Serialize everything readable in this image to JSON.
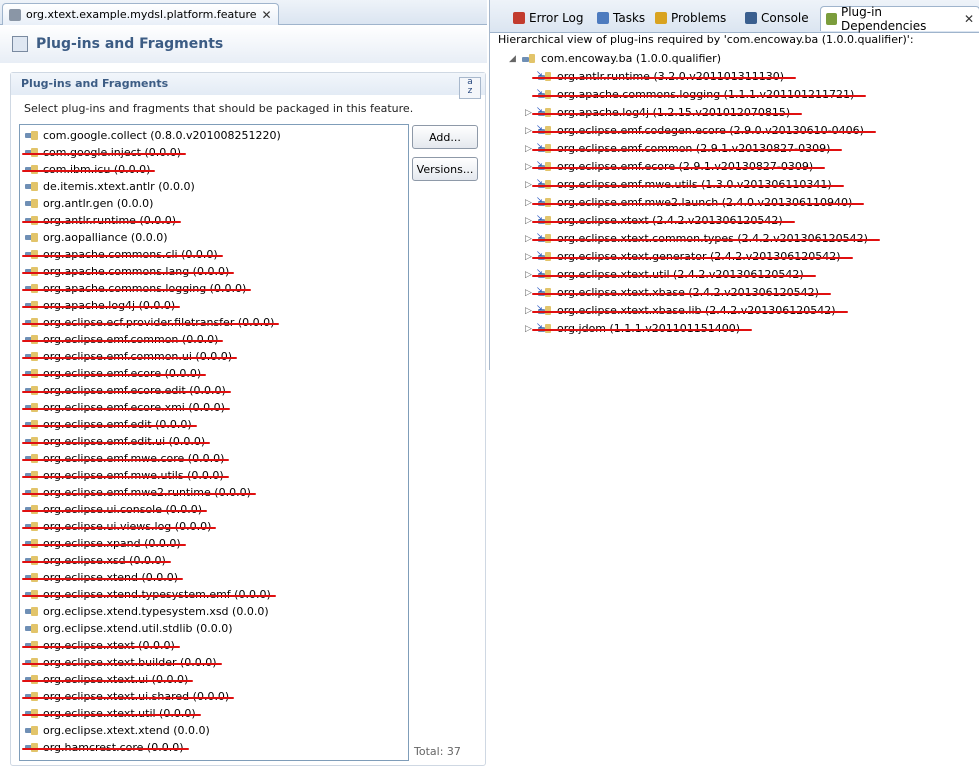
{
  "editor": {
    "tab_title": "org.xtext.example.mydsl.platform.feature",
    "page_title": "Plug-ins and Fragments",
    "section_title": "Plug-ins and Fragments",
    "section_description": "Select plug-ins and fragments that should be packaged in this feature.",
    "sort_button_label": "a\nz",
    "add_button": "Add...",
    "versions_button": "Versions...",
    "total_label": "Total: 37",
    "plugins": [
      {
        "label": "com.google.collect (0.8.0.v201008251220)",
        "struck": false
      },
      {
        "label": "com.google.inject (0.0.0)",
        "struck": true
      },
      {
        "label": "com.ibm.icu (0.0.0)",
        "struck": true
      },
      {
        "label": "de.itemis.xtext.antlr (0.0.0)",
        "struck": false
      },
      {
        "label": "org.antlr.gen (0.0.0)",
        "struck": false
      },
      {
        "label": "org.antlr.runtime (0.0.0)",
        "struck": true
      },
      {
        "label": "org.aopalliance (0.0.0)",
        "struck": false
      },
      {
        "label": "org.apache.commons.cli (0.0.0)",
        "struck": true
      },
      {
        "label": "org.apache.commons.lang (0.0.0)",
        "struck": true
      },
      {
        "label": "org.apache.commons.logging (0.0.0)",
        "struck": true
      },
      {
        "label": "org.apache.log4j (0.0.0)",
        "struck": true
      },
      {
        "label": "org.eclipse.ecf.provider.filetransfer (0.0.0)",
        "struck": true
      },
      {
        "label": "org.eclipse.emf.common (0.0.0)",
        "struck": true
      },
      {
        "label": "org.eclipse.emf.common.ui (0.0.0)",
        "struck": true
      },
      {
        "label": "org.eclipse.emf.ecore (0.0.0)",
        "struck": true
      },
      {
        "label": "org.eclipse.emf.ecore.edit (0.0.0)",
        "struck": true
      },
      {
        "label": "org.eclipse.emf.ecore.xmi (0.0.0)",
        "struck": true
      },
      {
        "label": "org.eclipse.emf.edit (0.0.0)",
        "struck": true
      },
      {
        "label": "org.eclipse.emf.edit.ui (0.0.0)",
        "struck": true
      },
      {
        "label": "org.eclipse.emf.mwe.core (0.0.0)",
        "struck": true
      },
      {
        "label": "org.eclipse.emf.mwe.utils (0.0.0)",
        "struck": true
      },
      {
        "label": "org.eclipse.emf.mwe2.runtime (0.0.0)",
        "struck": true
      },
      {
        "label": "org.eclipse.ui.console (0.0.0)",
        "struck": true
      },
      {
        "label": "org.eclipse.ui.views.log (0.0.0)",
        "struck": true
      },
      {
        "label": "org.eclipse.xpand (0.0.0)",
        "struck": true
      },
      {
        "label": "org.eclipse.xsd (0.0.0)",
        "struck": true
      },
      {
        "label": "org.eclipse.xtend (0.0.0)",
        "struck": true
      },
      {
        "label": "org.eclipse.xtend.typesystem.emf (0.0.0)",
        "struck": true
      },
      {
        "label": "org.eclipse.xtend.typesystem.xsd (0.0.0)",
        "struck": false
      },
      {
        "label": "org.eclipse.xtend.util.stdlib (0.0.0)",
        "struck": false
      },
      {
        "label": "org.eclipse.xtext (0.0.0)",
        "struck": true
      },
      {
        "label": "org.eclipse.xtext.builder (0.0.0)",
        "struck": true
      },
      {
        "label": "org.eclipse.xtext.ui (0.0.0)",
        "struck": true
      },
      {
        "label": "org.eclipse.xtext.ui.shared (0.0.0)",
        "struck": true
      },
      {
        "label": "org.eclipse.xtext.util (0.0.0)",
        "struck": true
      },
      {
        "label": "org.eclipse.xtext.xtend (0.0.0)",
        "struck": false
      },
      {
        "label": "org.hamcrest.core (0.0.0)",
        "struck": true
      }
    ]
  },
  "view": {
    "tabs": [
      {
        "label": "Error Log",
        "icon": "error-log-icon",
        "color": "#c23b2e"
      },
      {
        "label": "Tasks",
        "icon": "tasks-icon",
        "color": "#4d7bbf"
      },
      {
        "label": "Problems",
        "icon": "problems-icon",
        "color": "#d9a320"
      },
      {
        "label": "Console",
        "icon": "console-icon",
        "color": "#3a5f8f"
      },
      {
        "label": "Plug-in Dependencies",
        "icon": "plugin-dependencies-icon",
        "color": "#7b9d3c"
      }
    ],
    "active_tab": 4,
    "description": "Hierarchical view of plug-ins required by 'com.encoway.ba (1.0.0.qualifier)':",
    "root": "com.encoway.ba (1.0.0.qualifier)",
    "dependencies": [
      {
        "label": "org.antlr.runtime (3.2.0.v201101311130)",
        "expandable": false
      },
      {
        "label": "org.apache.commons.logging (1.1.1.v201101211721)",
        "expandable": false
      },
      {
        "label": "org.apache.log4j (1.2.15.v201012070815)",
        "expandable": true
      },
      {
        "label": "org.eclipse.emf.codegen.ecore (2.9.0.v20130610-0406)",
        "expandable": true
      },
      {
        "label": "org.eclipse.emf.common (2.9.1.v20130827-0309)",
        "expandable": true
      },
      {
        "label": "org.eclipse.emf.ecore (2.9.1.v20130827-0309)",
        "expandable": true
      },
      {
        "label": "org.eclipse.emf.mwe.utils (1.3.0.v201306110341)",
        "expandable": true
      },
      {
        "label": "org.eclipse.emf.mwe2.launch (2.4.0.v201306110940)",
        "expandable": true
      },
      {
        "label": "org.eclipse.xtext (2.4.2.v201306120542)",
        "expandable": true
      },
      {
        "label": "org.eclipse.xtext.common.types (2.4.2.v201306120542)",
        "expandable": true
      },
      {
        "label": "org.eclipse.xtext.generator (2.4.2.v201306120542)",
        "expandable": true
      },
      {
        "label": "org.eclipse.xtext.util (2.4.2.v201306120542)",
        "expandable": true
      },
      {
        "label": "org.eclipse.xtext.xbase (2.4.2.v201306120542)",
        "expandable": true
      },
      {
        "label": "org.eclipse.xtext.xbase.lib (2.4.2.v201306120542)",
        "expandable": true
      },
      {
        "label": "org.jdom (1.1.1.v201101151400)",
        "expandable": true
      }
    ]
  }
}
